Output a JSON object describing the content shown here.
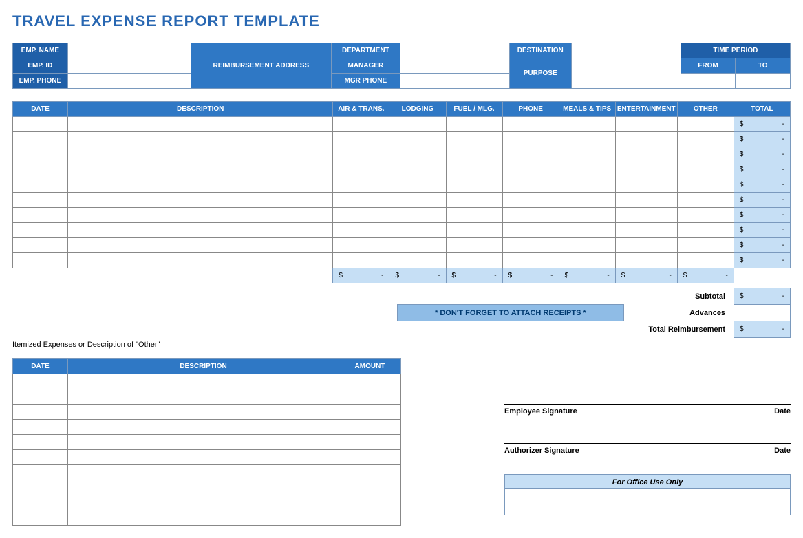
{
  "title": "TRAVEL EXPENSE REPORT TEMPLATE",
  "info": {
    "emp_name": "EMP. NAME",
    "emp_id": "EMP. ID",
    "emp_phone": "EMP. PHONE",
    "reimb_addr": "REIMBURSEMENT ADDRESS",
    "department": "DEPARTMENT",
    "manager": "MANAGER",
    "mgr_phone": "MGR PHONE",
    "destination": "DESTINATION",
    "purpose": "PURPOSE",
    "time_period": "TIME PERIOD",
    "from": "FROM",
    "to": "TO"
  },
  "grid_headers": {
    "date": "DATE",
    "desc": "DESCRIPTION",
    "air": "AIR & TRANS.",
    "lodging": "LODGING",
    "fuel": "FUEL / MLG.",
    "phone": "PHONE",
    "meals": "MEALS & TIPS",
    "ent": "ENTERTAINMENT",
    "other": "OTHER",
    "total": "TOTAL"
  },
  "row_total_placeholder_sym": "$",
  "row_total_placeholder_dash": "-",
  "summary": {
    "subtotal": "Subtotal",
    "advances": "Advances",
    "total_reimb": "Total Reimbursement",
    "receipts": "* DON'T FORGET TO ATTACH RECEIPTS *"
  },
  "itemized": {
    "note": "Itemized Expenses or Description of \"Other\"",
    "date": "DATE",
    "desc": "DESCRIPTION",
    "amount": "AMOUNT"
  },
  "sig": {
    "emp": "Employee Signature",
    "auth": "Authorizer Signature",
    "date": "Date"
  },
  "office": "For Office Use Only"
}
